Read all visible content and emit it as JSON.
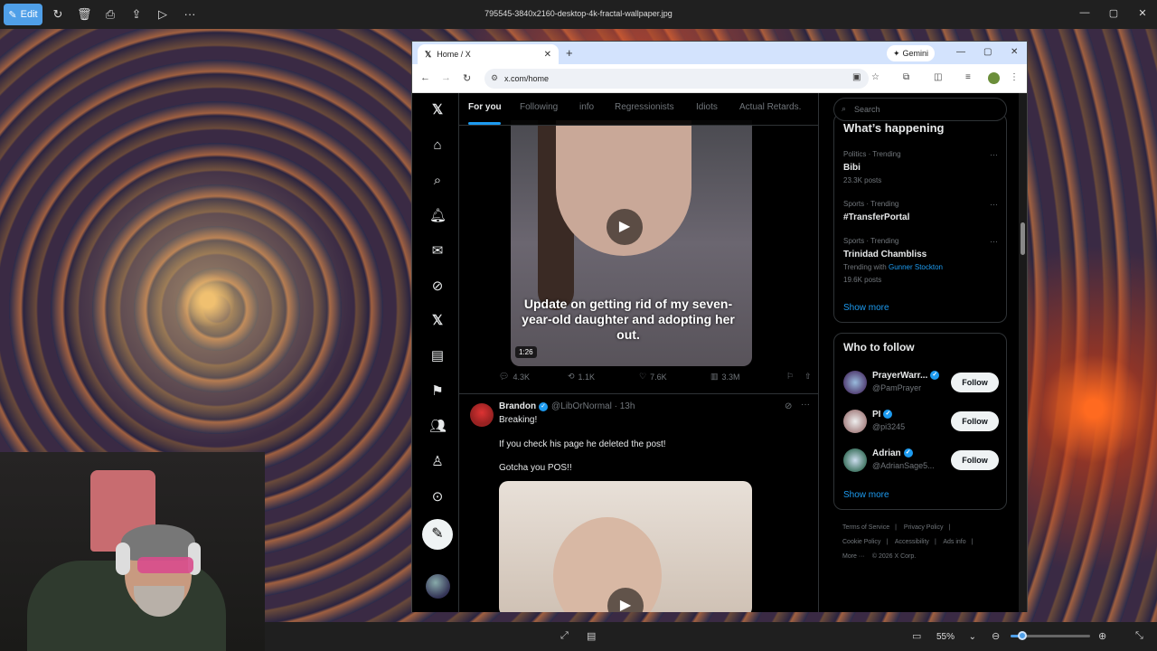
{
  "photos_app": {
    "edit_label": "Edit",
    "file_title": "795545-3840x2160-desktop-4k-fractal-wallpaper.jpg",
    "zoom_level": "55%"
  },
  "browser": {
    "tab_title": "Home / X",
    "gemini_label": "Gemini",
    "url": "x.com/home"
  },
  "x": {
    "tabs": [
      {
        "label": "For you"
      },
      {
        "label": "Following"
      },
      {
        "label": "info"
      },
      {
        "label": "Regressionists"
      },
      {
        "label": "Idiots"
      },
      {
        "label": "Actual Retards."
      }
    ],
    "tweet1": {
      "caption": "Update on getting rid of my seven-year-old daughter and adopting her out.",
      "duration": "1:26",
      "replies": "4.3K",
      "reposts": "1.1K",
      "likes": "7.6K",
      "views": "3.3M"
    },
    "tweet2": {
      "name": "Brandon",
      "handle": "@LibOrNormal · 13h",
      "line1": "Breaking!",
      "line2": "If you check his page he deleted the post!",
      "line3": "Gotcha you POS!!"
    },
    "search_placeholder": "Search",
    "trending": {
      "title": "What’s happening",
      "items": [
        {
          "meta": "Politics · Trending",
          "name": "Bibi",
          "posts": "23.3K posts"
        },
        {
          "meta": "Sports · Trending",
          "name": "#TransferPortal",
          "posts": ""
        },
        {
          "meta": "Sports · Trending",
          "name": "Trinidad Chambliss",
          "with_label": "Trending with",
          "with_link": "Gunner Stockton",
          "posts": "19.6K posts"
        }
      ],
      "show_more": "Show more"
    },
    "who_to_follow": {
      "title": "Who to follow",
      "users": [
        {
          "name": "PrayerWarr...",
          "handle": "@PamPrayer",
          "button": "Follow"
        },
        {
          "name": "PI",
          "handle": "@pi3245",
          "button": "Follow"
        },
        {
          "name": "Adrian",
          "handle": "@AdrianSage5...",
          "button": "Follow"
        }
      ],
      "show_more": "Show more"
    },
    "footer": {
      "links": [
        "Terms of Service",
        "|",
        "Privacy Policy",
        "|",
        "Cookie Policy",
        "|",
        "Accessibility",
        "|",
        "Ads info",
        "|",
        "More ···",
        "© 2026 X Corp."
      ]
    }
  },
  "colors": {
    "accent": "#1d9bf0",
    "edit_button": "#4f9fe8"
  }
}
